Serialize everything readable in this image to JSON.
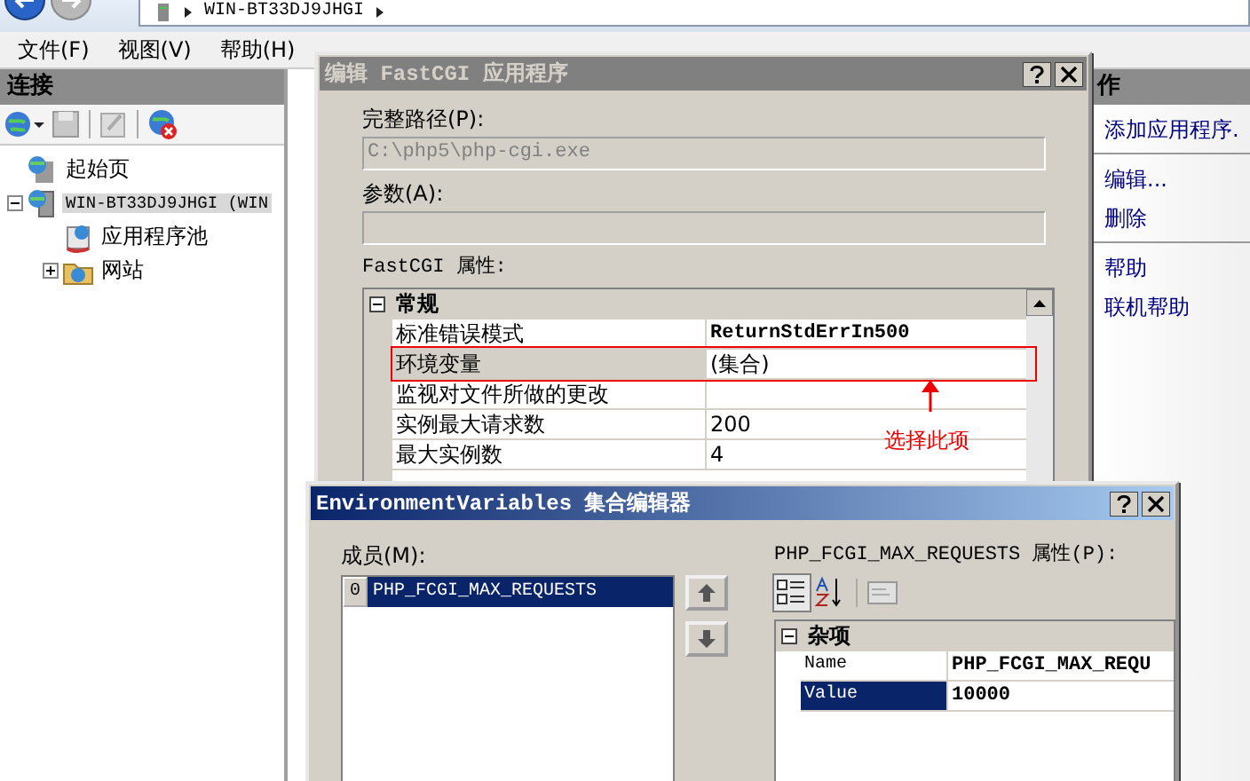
{
  "address": {
    "crumb": "WIN-BT33DJ9JHGI"
  },
  "menu": [
    "文件(F)",
    "视图(V)",
    "帮助(H)"
  ],
  "connections": {
    "title": "连接",
    "tree": [
      {
        "label": "起始页",
        "kind": "home",
        "selected": false
      },
      {
        "label": "WIN-BT33DJ9JHGI (WIN",
        "kind": "server",
        "selected": true,
        "expanded": true,
        "children": [
          {
            "label": "应用程序池",
            "kind": "pool",
            "selected": false
          },
          {
            "label": "网站",
            "kind": "sites",
            "selected": false,
            "expanded": false
          }
        ]
      }
    ]
  },
  "actions": {
    "title": "作",
    "groups": [
      [
        "添加应用程序."
      ],
      [
        "编辑...",
        "删除"
      ],
      [
        "帮助",
        "联机帮助"
      ]
    ]
  },
  "fastcgi_dialog": {
    "title": "编辑 FastCGI 应用程序",
    "active": false,
    "fields": [
      {
        "label": "完整路径(P):",
        "value": "C:\\php5\\php-cgi.exe",
        "disabled": true
      },
      {
        "label": "参数(A):",
        "disabled": true
      }
    ],
    "grid_label": "FastCGI 属性:",
    "grid": [
      {
        "category": "常规",
        "expanded": true,
        "rows": [
          {
            "name": "标准错误模式",
            "value": "ReturnStdErrIn500",
            "modified": true,
            "selected": false
          },
          {
            "name": "环境变量",
            "value": "(集合)",
            "modified": false,
            "selected": true
          },
          {
            "name": "监视对文件所做的更改",
            "selected": false
          },
          {
            "name": "实例最大请求数",
            "value": "200",
            "modified": false,
            "selected": false
          },
          {
            "name": "最大实例数",
            "value": "4",
            "modified": false,
            "selected": false
          }
        ]
      }
    ],
    "annotation": "选择此项"
  },
  "collection_dialog": {
    "title": "EnvironmentVariables 集合编辑器",
    "active": true,
    "members_label": "成员(M):",
    "members": [
      {
        "index": "0",
        "name": "PHP_FCGI_MAX_REQUESTS",
        "selected": true
      }
    ],
    "properties_label": "PHP_FCGI_MAX_REQUESTS 属性(P):",
    "toolbar": [
      {
        "kind": "categorized",
        "selected": true
      },
      {
        "kind": "alphabetical",
        "selected": false
      },
      {
        "kind": "pages",
        "selected": false
      }
    ],
    "grid": [
      {
        "category": "杂项",
        "expanded": true,
        "rows": [
          {
            "name": "Name",
            "value": "PHP_FCGI_MAX_REQU",
            "modified": true,
            "selected": false
          },
          {
            "name": "Value",
            "value": "10000",
            "modified": true,
            "selected": true
          }
        ]
      }
    ]
  }
}
